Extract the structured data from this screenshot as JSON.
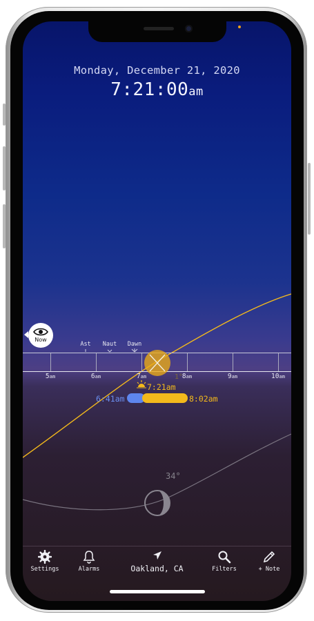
{
  "header": {
    "date": "Monday, December 21, 2020",
    "time": "7:21:00",
    "time_ampm": "am"
  },
  "now_button": {
    "label": "Now"
  },
  "twilight_labels": [
    "Ast",
    "Naut",
    "Dawn"
  ],
  "hours": [
    {
      "num": "5",
      "ap": "am"
    },
    {
      "num": "6",
      "ap": "am"
    },
    {
      "num": "7",
      "ap": "am"
    },
    {
      "num": "8",
      "ap": "am"
    },
    {
      "num": "9",
      "ap": "am"
    },
    {
      "num": "10",
      "ap": "am"
    }
  ],
  "sun_event": {
    "sunrise_time": "7:21am",
    "blue_start": "6:41am",
    "golden_end": "8:02am",
    "sun_elevation": "1°",
    "moon_elevation": "34°"
  },
  "tabbar": {
    "settings": "Settings",
    "alarms": "Alarms",
    "location": "Oakland, CA",
    "filters": "Filters",
    "note": "+ Note"
  },
  "colors": {
    "gold": "#f3b91c",
    "blue": "#5e86ee",
    "sky_top": "#07156a"
  }
}
